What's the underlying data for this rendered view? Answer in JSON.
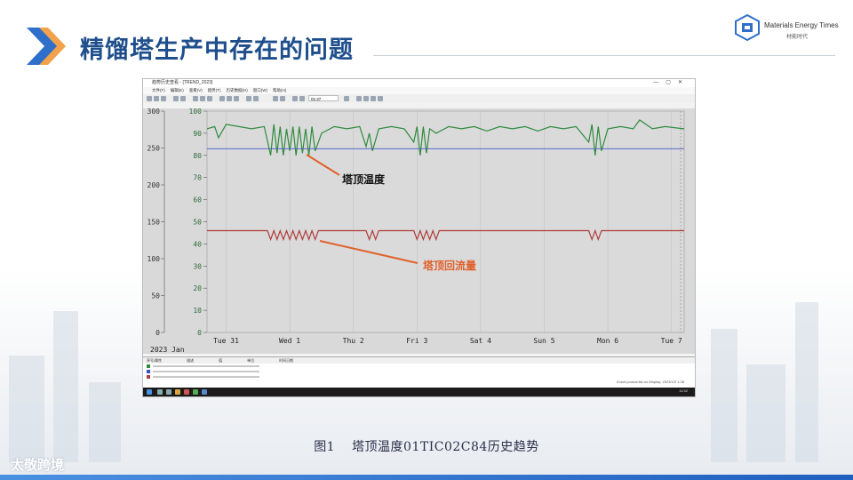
{
  "slide": {
    "title": "精馏塔生产中存在的问题",
    "logo": {
      "name": "Materials Energy Times",
      "subtitle": "材能时代",
      "icon": "cube-logo-icon"
    },
    "caption_number": "图1",
    "caption_text": "塔顶温度01TIC02C84历史趋势",
    "watermark": "太敬跨境",
    "accent_color": "#1f4e8c"
  },
  "window": {
    "title": "趋势历史查看 - [TREND_2023]",
    "menu": [
      "文件(F)",
      "编辑(E)",
      "查看(V)",
      "趋势(T)",
      "历史数据(H)",
      "窗口(W)",
      "帮助(H)"
    ],
    "time_field": "01:37",
    "status_text": "Event journal list on   Display: 2023/1/2 1:38",
    "legend_headers": [
      "序号/属性",
      "描述",
      "值",
      "单位",
      "时间日期"
    ],
    "legend_rows": [
      {
        "color": "#2e8b3e"
      },
      {
        "color": "#3b4cc0"
      },
      {
        "color": "#b03a3a"
      }
    ],
    "clock": "11:52"
  },
  "chart_data": {
    "type": "line",
    "year_label": "2023 Jan",
    "left_axis": {
      "ylim": [
        0,
        300
      ],
      "ticks": [
        0,
        50,
        100,
        150,
        200,
        250,
        300
      ]
    },
    "right_axis": {
      "ylim": [
        0,
        100
      ],
      "ticks": [
        0,
        10,
        20,
        30,
        40,
        50,
        60,
        70,
        80,
        90,
        100
      ]
    },
    "x_ticks": [
      "Tue 31",
      "Wed 1",
      "Thu 2",
      "Fri 3",
      "Sat 4",
      "Sun 5",
      "Mon 6",
      "Tue 7"
    ],
    "series": [
      {
        "name": "塔顶温度",
        "color": "#2e8b3e",
        "axis": "right",
        "x": [
          0,
          0.12,
          0.18,
          0.3,
          0.5,
          0.7,
          0.9,
          1.0,
          1.05,
          1.1,
          1.15,
          1.2,
          1.25,
          1.3,
          1.35,
          1.4,
          1.45,
          1.5,
          1.55,
          1.6,
          1.65,
          1.7,
          1.8,
          2.0,
          2.2,
          2.4,
          2.5,
          2.55,
          2.6,
          2.7,
          2.9,
          3.1,
          3.25,
          3.3,
          3.35,
          3.4,
          3.45,
          3.5,
          3.6,
          3.8,
          4.0,
          4.2,
          4.4,
          4.6,
          4.8,
          5.0,
          5.2,
          5.4,
          5.6,
          5.8,
          6.0,
          6.05,
          6.1,
          6.15,
          6.2,
          6.3,
          6.5,
          6.7,
          6.8,
          7.0,
          7.2,
          7.5
        ],
        "values": [
          92,
          93,
          88,
          94,
          93,
          92,
          93,
          80,
          94,
          81,
          93,
          80,
          92,
          82,
          93,
          80,
          93,
          81,
          92,
          80,
          93,
          82,
          90,
          93,
          92,
          93,
          84,
          90,
          82,
          92,
          93,
          92,
          86,
          93,
          80,
          93,
          81,
          92,
          90,
          93,
          92,
          93,
          91,
          93,
          92,
          93,
          91,
          93,
          92,
          93,
          86,
          94,
          80,
          93,
          82,
          92,
          93,
          92,
          96,
          92,
          93,
          92
        ]
      },
      {
        "name": "",
        "color": "#4b57c8",
        "axis": "right",
        "x": [
          0,
          7.5
        ],
        "values": [
          83,
          83
        ]
      },
      {
        "name": "塔顶回流量",
        "color": "#b03a3a",
        "axis": "right",
        "x": [
          0,
          0.95,
          1.0,
          1.05,
          1.1,
          1.15,
          1.2,
          1.25,
          1.3,
          1.35,
          1.4,
          1.45,
          1.5,
          1.55,
          1.6,
          1.65,
          1.7,
          1.75,
          2.5,
          2.55,
          2.6,
          2.65,
          2.7,
          3.25,
          3.3,
          3.35,
          3.4,
          3.45,
          3.5,
          3.55,
          3.6,
          3.65,
          6.0,
          6.05,
          6.1,
          6.15,
          6.2,
          7.5
        ],
        "values": [
          46,
          46,
          42,
          46,
          42,
          46,
          42,
          46,
          42,
          46,
          42,
          46,
          42,
          46,
          42,
          46,
          42,
          46,
          46,
          42,
          46,
          42,
          46,
          46,
          42,
          46,
          42,
          46,
          42,
          46,
          42,
          46,
          46,
          42,
          46,
          42,
          46,
          46
        ]
      }
    ],
    "annotations": [
      "塔顶温度",
      "塔顶回流量"
    ],
    "grid": true
  }
}
